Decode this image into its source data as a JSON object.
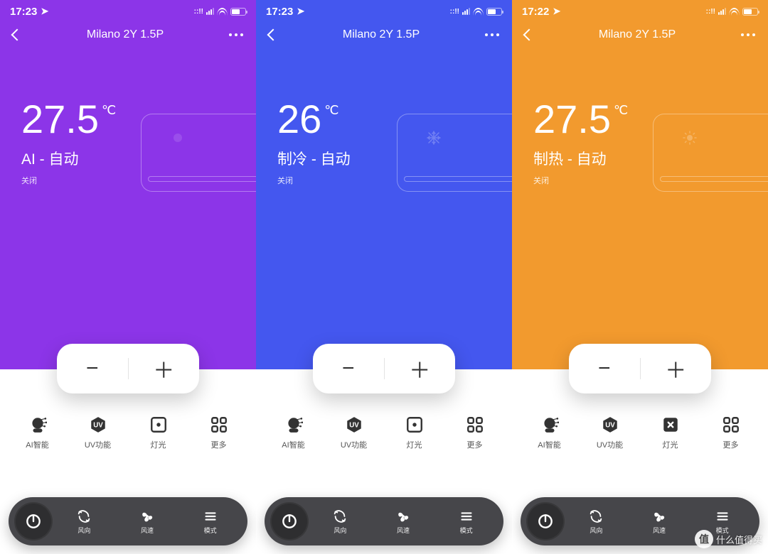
{
  "screens": [
    {
      "bg": "bg-purple",
      "status_time": "17:23",
      "header_title": "Milano 2Y 1.5P",
      "temp": "27.5",
      "unit": "℃",
      "mode": "AI - 自动",
      "sub": "关闭",
      "mode_icon": "ai"
    },
    {
      "bg": "bg-blue",
      "status_time": "17:23",
      "header_title": "Milano 2Y 1.5P",
      "temp": "26",
      "unit": "℃",
      "mode": "制冷 - 自动",
      "sub": "关闭",
      "mode_icon": "snow"
    },
    {
      "bg": "bg-orange",
      "status_time": "17:22",
      "header_title": "Milano 2Y 1.5P",
      "temp": "27.5",
      "unit": "℃",
      "mode": "制热 - 自动",
      "sub": "关闭",
      "mode_icon": "sun"
    }
  ],
  "quick_labels": {
    "ai": "AI智能",
    "uv": "UV功能",
    "light": "灯光",
    "more": "更多"
  },
  "bottom_labels": {
    "direction": "风向",
    "speed": "风速",
    "mode": "模式"
  },
  "pm": {
    "minus": "−",
    "plus": "＋"
  },
  "watermark": {
    "badge": "值",
    "text": "什么值得买"
  }
}
